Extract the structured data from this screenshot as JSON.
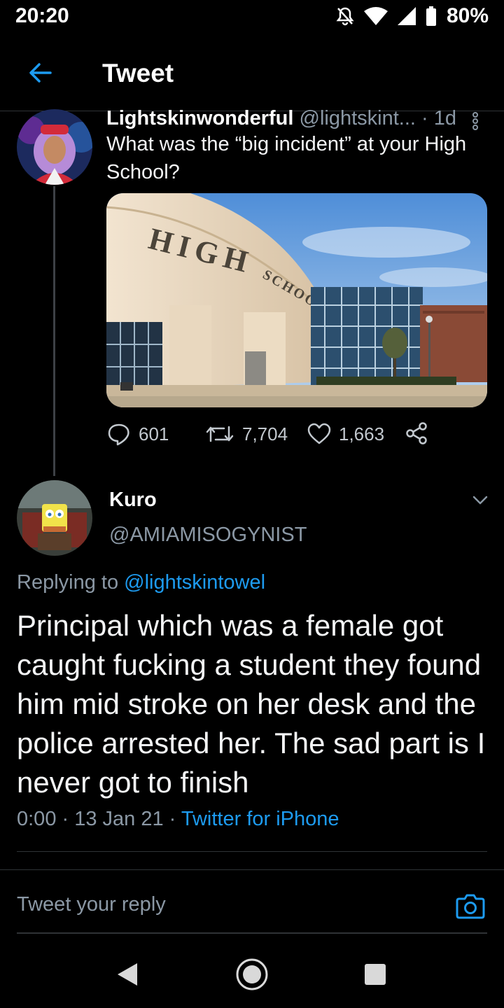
{
  "status_bar": {
    "time": "20:20",
    "battery": "80%"
  },
  "header": {
    "title": "Tweet",
    "back_icon": "arrow-left-icon"
  },
  "quoted_tweet": {
    "name": "Lightskinwonderful",
    "handle": "@lightskint...",
    "age": "· 1d",
    "text": "What was the “big incident” at your High School?",
    "media_sign_line1": "HIGH",
    "media_sign_line2": "SCHOOL",
    "replies": "601",
    "retweets": "7,704",
    "likes": "1,663"
  },
  "reply": {
    "name": "Kuro",
    "handle": "@AMIAMISOGYNIST",
    "replying_prefix": "Replying to ",
    "replying_handle": "@lightskintowel",
    "text": "Principal which was a female got caught fucking a student they found him mid stroke on her desk and the police arrested her. The sad part is I never got to finish",
    "time": "0:00 · 13 Jan 21 · ",
    "source": "Twitter for iPhone"
  },
  "composer": {
    "placeholder": "Tweet your reply"
  },
  "colors": {
    "accent": "#1d9bf0",
    "secondary_text": "#8b98a5",
    "background": "#000000"
  }
}
